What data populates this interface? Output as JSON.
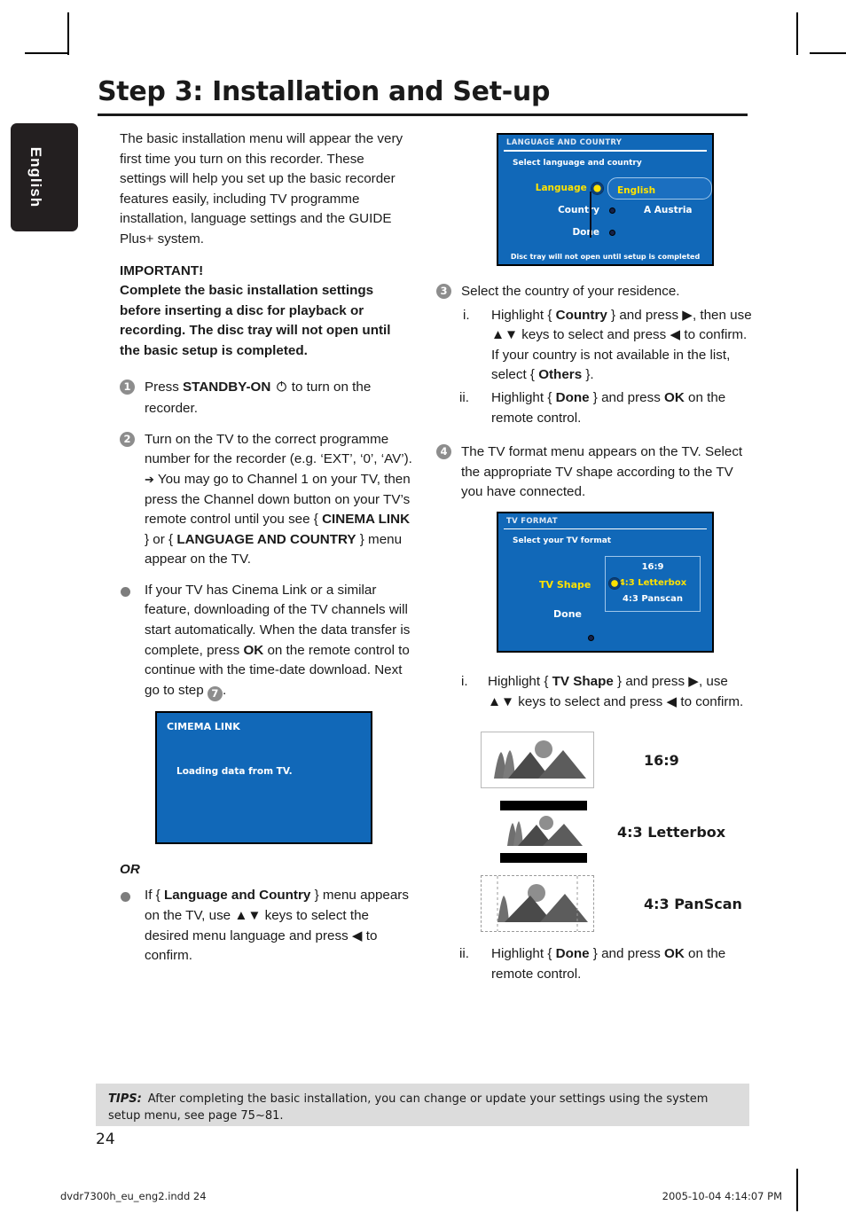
{
  "page": {
    "title": "Step 3: Installation and Set-up",
    "language_tab": "English",
    "page_number": "24",
    "footer_left": "dvdr7300h_eu_eng2.indd   24",
    "footer_right": "2005-10-04   4:14:07 PM"
  },
  "left": {
    "intro": "The basic installation menu will appear the very first time you turn on this recorder. These settings will help you set up the basic recorder features easily, including TV programme installation, language settings and the GUIDE Plus+ system.",
    "important_heading": "IMPORTANT!",
    "important_body": "Complete the basic installation settings before inserting a disc for playback or recording. The disc tray will not open until the basic setup is completed.",
    "step1_num": "1",
    "step1_a": "Press ",
    "step1_b": "STANDBY-ON",
    "step1_icon": "power-icon",
    "step1_c": " to turn on the recorder.",
    "step2_num": "2",
    "step2_line1": "Turn on the TV to the correct programme number for the recorder (e.g. ‘EXT’, ‘0’, ‘AV’).",
    "step2_arrow": "➔",
    "step2_line2_a": "You may go to Channel 1 on your TV, then press the Channel down button on your TV’s remote control until you see { ",
    "step2_link1": "CINEMA LINK",
    "step2_line2_b": " } or { ",
    "step2_link2": "LANGUAGE AND COUNTRY",
    "step2_line2_c": " } menu appear on the TV.",
    "bullet1_a": "If your TV has Cinema Link or a similar feature, downloading of the TV channels will start automatically. When the data transfer is complete, press ",
    "bullet1_ok": "OK",
    "bullet1_b": " on the remote control to continue with the time-date download. Next go to step ",
    "bullet1_step": "7",
    "bullet1_c": ".",
    "or_label": "OR",
    "bullet2_a": "If { ",
    "bullet2_b": "Language and Country",
    "bullet2_c": " } menu appears on the TV, use ",
    "bullet2_keys": "▲▼",
    "bullet2_d": " keys to select the desired menu language and press ",
    "bullet2_left": "◀",
    "bullet2_e": " to confirm."
  },
  "cinema_link_screen": {
    "title": "CIMEMA LINK",
    "message": "Loading data from TV.",
    "bg_color": "#1168b8"
  },
  "language_country_screen": {
    "title": "LANGUAGE AND COUNTRY",
    "subtitle": "Select language and country",
    "rows": [
      {
        "label": "Language",
        "value": "English",
        "selected": true
      },
      {
        "label": "Country",
        "value": "A Austria",
        "selected": false
      },
      {
        "label": "Done",
        "value": "",
        "selected": false
      }
    ],
    "footer": "Disc tray will not open until setup is completed",
    "bg_color": "#1168b8",
    "highlight_color": "#ffe200"
  },
  "tv_format_screen": {
    "title": "TV FORMAT",
    "subtitle": "Select your TV format",
    "shape_label": "TV Shape",
    "done_label": "Done",
    "options": [
      {
        "label": "16:9",
        "selected": false
      },
      {
        "label": "4:3 Letterbox",
        "selected": true
      },
      {
        "label": "4:3 Panscan",
        "selected": false
      }
    ],
    "bg_color": "#1168b8"
  },
  "right": {
    "step3_num": "3",
    "step3_title": "Select the country of your residence.",
    "step3_i_rn": "i.",
    "step3_i_a": "Highlight { ",
    "step3_i_country": "Country",
    "step3_i_b": " } and press ",
    "step3_i_right": "▶",
    "step3_i_c": ", then use ",
    "step3_i_keys": "▲▼",
    "step3_i_d": " keys to select and press ",
    "step3_i_left": "◀",
    "step3_i_e": " to confirm. If your country is not available in the list, select { ",
    "step3_i_others": "Others",
    "step3_i_f": " }.",
    "step3_ii_rn": "ii.",
    "step3_ii_a": "Highlight { ",
    "step3_ii_done": "Done",
    "step3_ii_b": " } and press ",
    "step3_ii_ok": "OK",
    "step3_ii_c": " on the remote control.",
    "step4_num": "4",
    "step4_text": "The TV format menu appears on the TV. Select the appropriate TV shape according to the TV you have connected.",
    "step4_i_rn": "i.",
    "step4_i_a": "Highlight { ",
    "step4_i_shape": "TV Shape",
    "step4_i_b": " } and press ",
    "step4_i_right": "▶",
    "step4_i_c": ", use ",
    "step4_i_keys": "▲▼",
    "step4_i_d": " keys to select and press ",
    "step4_i_left": "◀",
    "step4_i_e": " to confirm.",
    "step4_ii_rn": "ii.",
    "step4_ii_a": "Highlight { ",
    "step4_ii_done": "Done",
    "step4_ii_b": " } and press ",
    "step4_ii_ok": "OK",
    "step4_ii_c": " on the remote control.",
    "shapes": [
      {
        "label": "16:9",
        "style": "wide"
      },
      {
        "label": "4:3 Letterbox",
        "style": "letterbox"
      },
      {
        "label": "4:3 PanScan",
        "style": "panscan"
      }
    ]
  },
  "tips": {
    "label": "TIPS:",
    "text": "After completing the basic installation, you can change or update your settings using the system setup menu, see page 75~81."
  }
}
